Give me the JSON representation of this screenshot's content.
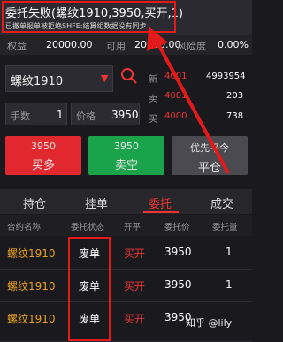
{
  "notice": {
    "title": "委托失败(螺纹1910,3950,买开,1)",
    "subtitle": "已撤单报单被拒绝SHFE:结算组数据没有同步"
  },
  "account": {
    "equity_label": "权益",
    "equity_value": "20000.00",
    "available_label": "可用",
    "available_value": "20000.00",
    "risk_label": "风险度",
    "risk_value": "0.00%"
  },
  "order_form": {
    "contract": "螺纹1910",
    "qty_label": "手数",
    "qty_value": "1",
    "price_label": "价格",
    "price_value": "3950",
    "quotes": {
      "last_label": "新",
      "last_price": "4001",
      "last_value": "4993954",
      "sell_label": "卖",
      "sell_price": "4001",
      "sell_vol": "203",
      "buy_label": "买",
      "buy_price": "4000",
      "buy_vol": "738"
    },
    "buttons": {
      "buy_price": "3950",
      "buy_label": "买多",
      "sell_price": "3950",
      "sell_label": "卖空",
      "close_price": "优先平今",
      "close_label": "平仓"
    }
  },
  "tabs": [
    "持仓",
    "挂单",
    "委托",
    "成交"
  ],
  "active_tab": "委托",
  "table": {
    "headers": [
      "合约名称",
      "委托状态",
      "开平",
      "委托价",
      "委托量"
    ],
    "rows": [
      {
        "name": "螺纹1910",
        "status": "废单",
        "oc": "买开",
        "price": "3950",
        "qty": "1"
      },
      {
        "name": "螺纹1910",
        "status": "废单",
        "oc": "买开",
        "price": "3950",
        "qty": "1"
      },
      {
        "name": "螺纹1910",
        "status": "废单",
        "oc": "买开",
        "price": "3950",
        "qty": "1"
      }
    ]
  },
  "watermark": "知乎 @lily",
  "colors": {
    "buy": "#e0282e",
    "sell": "#1aa34a",
    "neutral": "#4a4a50",
    "gold": "#e8a020",
    "red": "#e33333",
    "highlight_box": "#e31a1a"
  }
}
